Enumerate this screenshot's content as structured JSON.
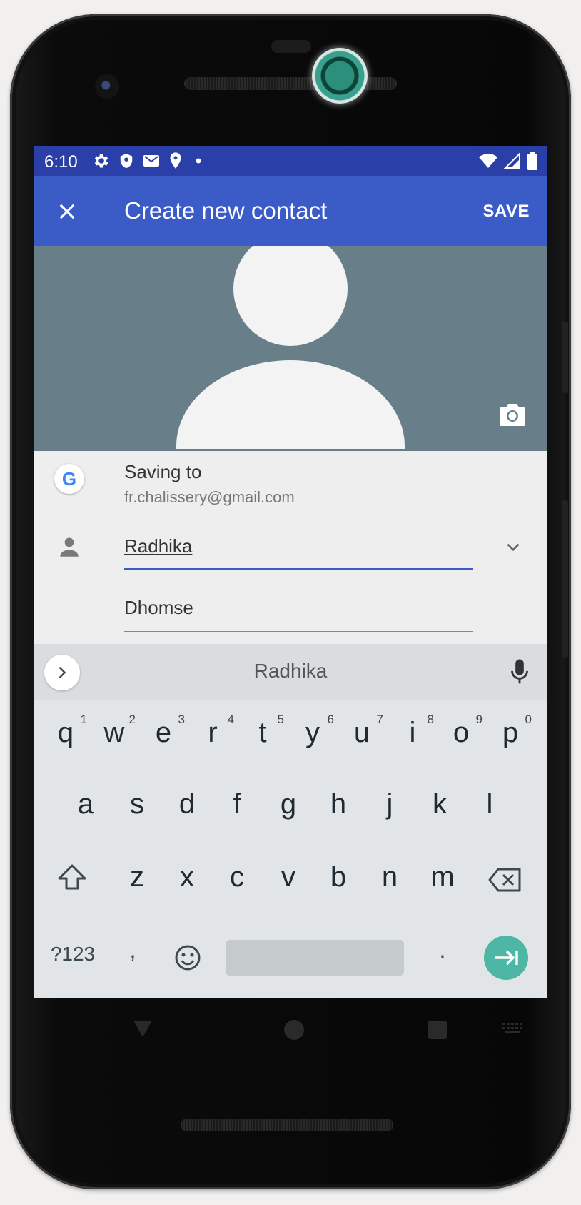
{
  "status_bar": {
    "time": "6:10",
    "left_icons": [
      "settings-icon",
      "shield-icon",
      "mail-icon",
      "location-icon",
      "dot-icon"
    ],
    "right_icons": [
      "wifi-icon",
      "signal-icon",
      "battery-icon"
    ]
  },
  "app_bar": {
    "close_icon": "close-icon",
    "title": "Create new contact",
    "save_label": "SAVE",
    "color": "#3b5bc6"
  },
  "photo": {
    "camera_icon": "camera-icon",
    "background": "#687f8a"
  },
  "account": {
    "label": "Saving to",
    "email": "fr.chalissery@gmail.com",
    "logo": "G"
  },
  "name": {
    "first_name": "Radhika",
    "last_name": "Dhomse",
    "expand_icon": "chevron-down-icon"
  },
  "keyboard": {
    "suggestion": "Radhika",
    "row1": [
      {
        "key": "q",
        "hint": "1"
      },
      {
        "key": "w",
        "hint": "2"
      },
      {
        "key": "e",
        "hint": "3"
      },
      {
        "key": "r",
        "hint": "4"
      },
      {
        "key": "t",
        "hint": "5"
      },
      {
        "key": "y",
        "hint": "6"
      },
      {
        "key": "u",
        "hint": "7"
      },
      {
        "key": "i",
        "hint": "8"
      },
      {
        "key": "o",
        "hint": "9"
      },
      {
        "key": "p",
        "hint": "0"
      }
    ],
    "row2": [
      "a",
      "s",
      "d",
      "f",
      "g",
      "h",
      "j",
      "k",
      "l"
    ],
    "row3": [
      "z",
      "x",
      "c",
      "v",
      "b",
      "n",
      "m"
    ],
    "symbols_label": "?123",
    "comma": ",",
    "period": ".",
    "enter_color": "#4db6a5"
  },
  "nav_bar": [
    "back-icon",
    "home-icon",
    "recents-icon",
    "keyboard-switch-icon"
  ]
}
